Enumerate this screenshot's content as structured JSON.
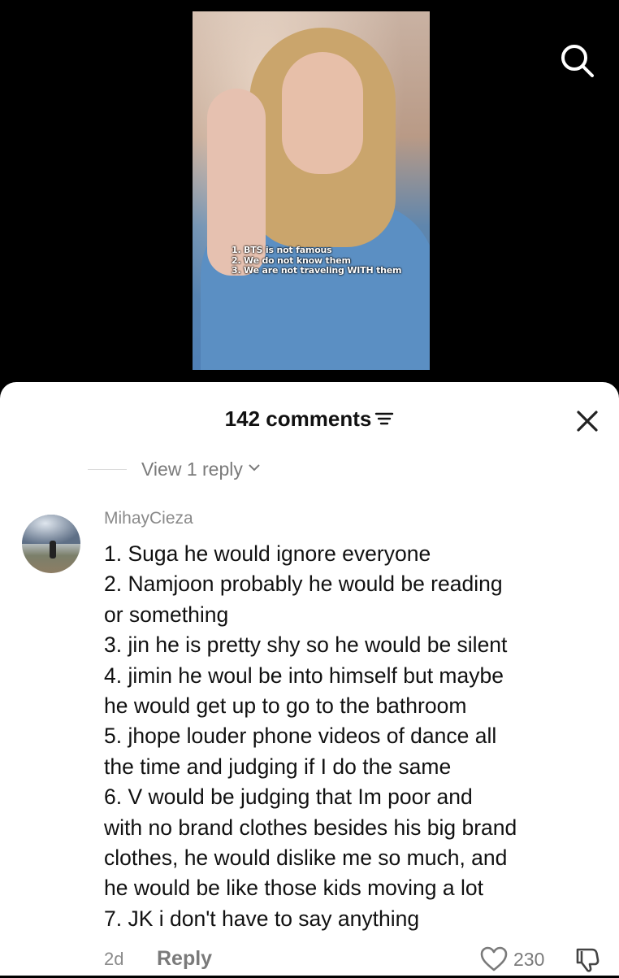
{
  "video": {
    "caption_lines": [
      "1. BTS is not famous",
      "2. We do not know them",
      "3. We are not traveling WITH them"
    ]
  },
  "icons": {
    "search": "search-icon",
    "filter": "filter-icon",
    "close": "close-icon",
    "chevron": "chevron-down-icon",
    "like": "heart-icon",
    "dislike": "thumbs-down-icon"
  },
  "comments_panel": {
    "title": "142 comments",
    "view_reply": "View 1 reply"
  },
  "comment": {
    "username": "MihayCieza",
    "lines": [
      "1. Suga he would ignore everyone",
      "2. Namjoon probably he would be reading",
      "or something",
      "3. jin he is pretty shy so he would be silent",
      "4. jimin he woul be into himself but maybe",
      "he would get up to go to the bathroom",
      "5. jhope louder phone videos of dance all",
      "the time and judging if I do the same",
      "6. V would be judging that Im poor and",
      "with no brand clothes besides his big brand",
      "clothes, he would dislike me so much, and",
      "he would be like those kids moving a lot",
      "7. JK i don't have to say anything"
    ],
    "time": "2d",
    "reply_label": "Reply",
    "like_count": "230"
  }
}
